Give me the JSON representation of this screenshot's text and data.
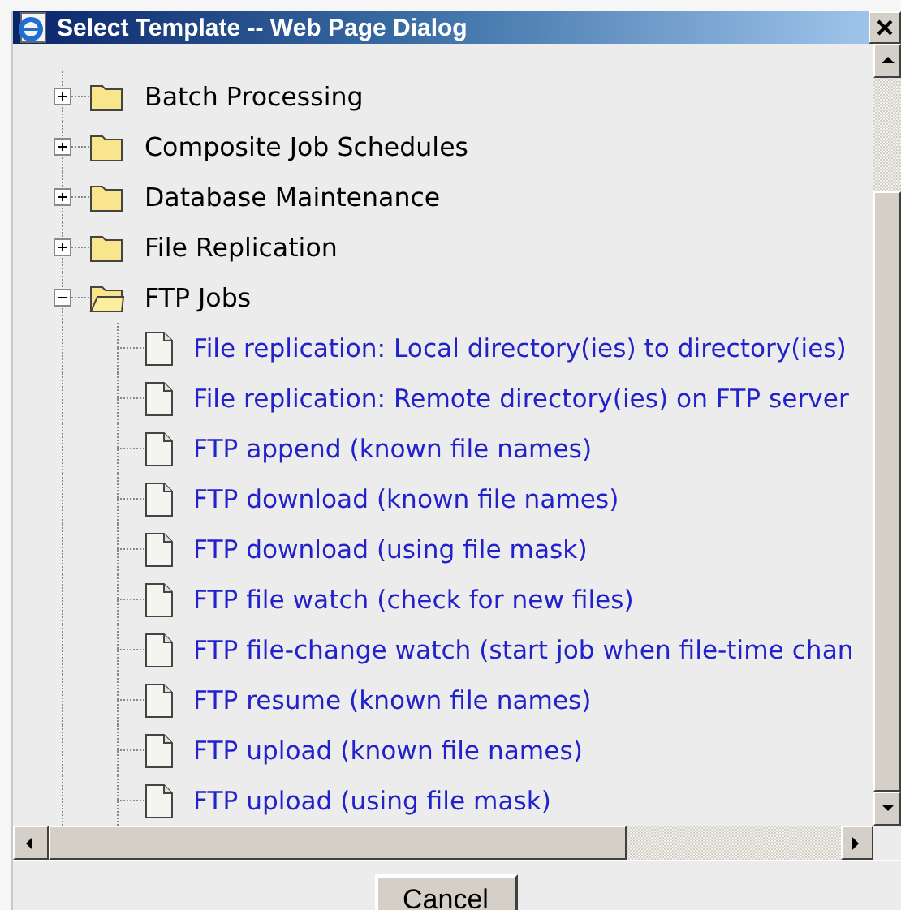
{
  "window": {
    "title": "Select Template -- Web Page Dialog"
  },
  "tree": [
    {
      "kind": "folder",
      "label": "Batch Processing",
      "expanded": false
    },
    {
      "kind": "folder",
      "label": "Composite Job Schedules",
      "expanded": false
    },
    {
      "kind": "folder",
      "label": "Database Maintenance",
      "expanded": false
    },
    {
      "kind": "folder",
      "label": "File Replication",
      "expanded": false
    },
    {
      "kind": "folder",
      "label": "FTP Jobs",
      "expanded": true,
      "children": [
        {
          "kind": "template",
          "label": "File replication: Local directory(ies) to directory(ies)"
        },
        {
          "kind": "template",
          "label": "File replication: Remote directory(ies) on FTP server"
        },
        {
          "kind": "template",
          "label": "FTP append (known file names)"
        },
        {
          "kind": "template",
          "label": "FTP download (known file names)"
        },
        {
          "kind": "template",
          "label": "FTP download (using file mask)"
        },
        {
          "kind": "template",
          "label": "FTP file watch (check for new files)"
        },
        {
          "kind": "template",
          "label": "FTP file-change watch (start job when file-time chan"
        },
        {
          "kind": "template",
          "label": "FTP resume (known file names)"
        },
        {
          "kind": "template",
          "label": "FTP upload (known file names)"
        },
        {
          "kind": "template",
          "label": "FTP upload (using file mask)"
        }
      ]
    }
  ],
  "buttons": [
    "Cancel"
  ]
}
